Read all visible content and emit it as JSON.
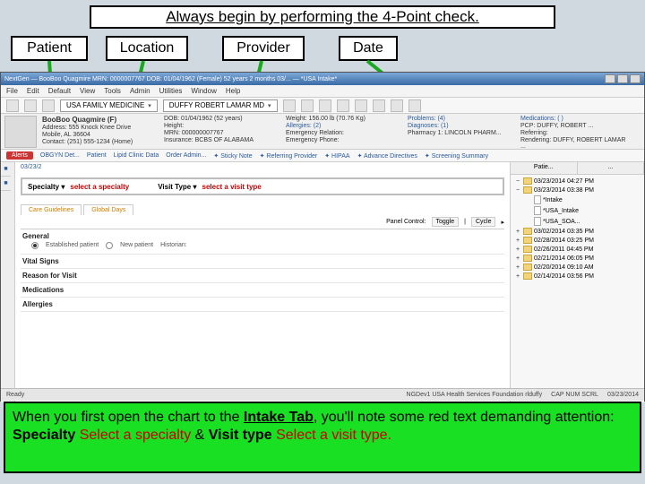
{
  "title": "Always begin by performing the 4-Point check.",
  "boxes": {
    "b1": "Patient",
    "b2": "Location",
    "b3": "Provider",
    "b4": "Date"
  },
  "app": {
    "titlebar": "NextGen — BooBoo Quagmire  MRN: 0000007767  DOB: 01/04/1962 (Female)  52 years 2 months  03/... — *USA Intake*",
    "menus": [
      "File",
      "Edit",
      "Default",
      "View",
      "Tools",
      "Admin",
      "Utilities",
      "Window",
      "Help"
    ],
    "toolbar": {
      "practice": "USA FAMILY MEDICINE",
      "provider": "DUFFY ROBERT LAMAR MD"
    },
    "patient": {
      "name": "BooBoo Quagmire (F)",
      "dob": "DOB: 01/04/1962 (52 years)",
      "address1": "Address: 555 Knock Knee Drive",
      "address2": "Mobile, AL 36604",
      "phone": "Contact: (251) 555-1234 (Home)",
      "height": "Height:",
      "weight": "Weight: 156.00 lb (70.76 Kg)",
      "mrn": "MRN: 000000007767",
      "insurance": "Insurance: BCBS OF ALABAMA",
      "allergies": "Allergies: (2)",
      "problems": "Problems: (4)",
      "diagnoses": "Diagnoses: (1)",
      "medications": "Medications: ( )",
      "emrel": "Emergency Relation:",
      "emph": "Emergency Phone:",
      "pharm": "Pharmacy 1: LINCOLN PHARM...",
      "pcp": "PCP: DUFFY, ROBERT ...",
      "referring": "Referring:",
      "rendering": "Rendering: DUFFY, ROBERT LAMAR ..."
    },
    "linksbar": {
      "alerts": "Alerts",
      "detail": "OBGYN Det...",
      "items": [
        "Patient",
        "Lipid Clinic Data",
        "Order Admin...",
        "✦ Sticky Note",
        "✦ Referring Provider",
        "✦ HIPAA",
        "✦ Advance Directives",
        "✦ Screening Summary"
      ]
    },
    "dateheader": "03/23/2",
    "specialty": {
      "spLabel": "Specialty ▾",
      "spPrompt": "select a specialty",
      "vtLabel": "Visit Type ▾",
      "vtPrompt": "select a visit type"
    },
    "subtabs": [
      "Care Guidelines",
      "Global Days"
    ],
    "panelctl": {
      "lbl": "Panel Control:",
      "toggle": "Toggle",
      "cycle": "Cycle"
    },
    "sections": {
      "general": "General",
      "estpt": "Established patient",
      "newpt": "New patient",
      "hist": "Historian:",
      "vitals": "Vital Signs",
      "reason": "Reason for Visit",
      "meds": "Medications",
      "allerg": "Allergies"
    },
    "right": {
      "tabs": [
        "Patie...",
        "..."
      ],
      "top": "03/23/2014 04:27 PM",
      "rows": [
        {
          "pm": "−",
          "type": "fld",
          "label": "03/23/2014 03:38 PM"
        },
        {
          "pm": " ",
          "type": "doc",
          "label": "*Intake",
          "indent": 1
        },
        {
          "pm": " ",
          "type": "doc",
          "label": "*USA_Intake",
          "indent": 1
        },
        {
          "pm": " ",
          "type": "doc",
          "label": "*USA_SOA...",
          "indent": 1
        },
        {
          "pm": "+",
          "type": "fld",
          "label": "03/02/2014 03:35 PM"
        },
        {
          "pm": "+",
          "type": "fld",
          "label": "02/28/2014 03:25 PM"
        },
        {
          "pm": "+",
          "type": "fld",
          "label": "02/26/2011 04:45 PM"
        },
        {
          "pm": "+",
          "type": "fld",
          "label": "02/21/2014 06:05 PM"
        },
        {
          "pm": "+",
          "type": "fld",
          "label": "02/20/2014 09:10 AM"
        },
        {
          "pm": "+",
          "type": "fld",
          "label": "02/14/2014 03:56 PM"
        }
      ]
    },
    "status": {
      "ready": "Ready",
      "env": "NGDev1 USA Health Services Foundation rlduffy",
      "caps": "CAP NUM SCRL",
      "date": "03/23/2014"
    }
  },
  "explain": {
    "l1a": "When you first open the chart to the ",
    "l1b": "Intake Tab",
    "l1c": ", you'll note some red text demanding attention:",
    "l2a": "Specialty ",
    "l2b": "Select a specialty",
    "l2c": " & ",
    "l2d": "Visit type ",
    "l2e": "Select a visit type."
  }
}
